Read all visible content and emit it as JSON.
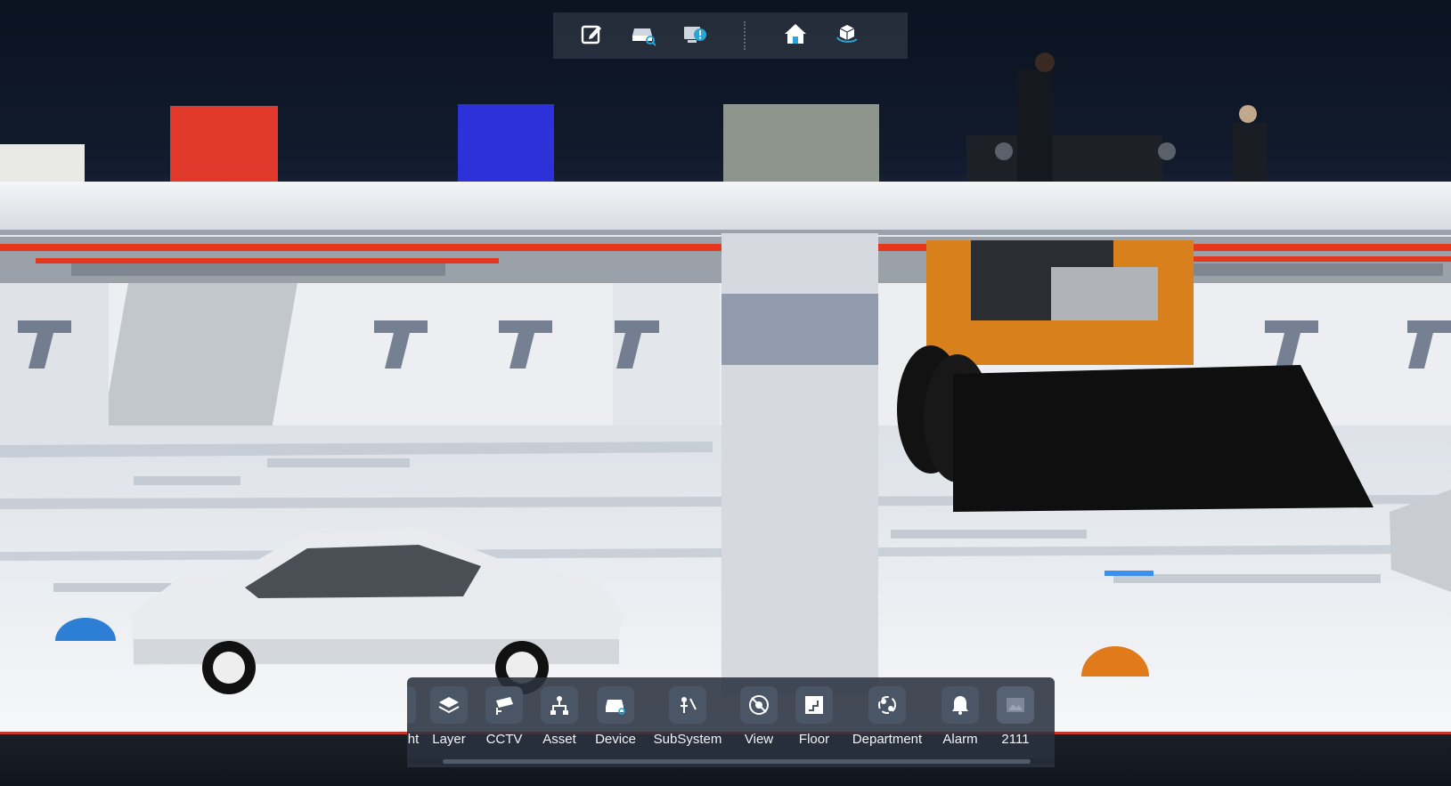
{
  "toolbar": {
    "buttons": [
      {
        "icon": "edit-icon"
      },
      {
        "icon": "device-search-icon"
      },
      {
        "icon": "device-alert-icon"
      },
      {
        "icon": "home-icon"
      },
      {
        "icon": "cube-rotate-icon"
      }
    ]
  },
  "bottom_menu": {
    "items": [
      {
        "label": "ht",
        "icon": "light-icon"
      },
      {
        "label": "Layer",
        "icon": "layer-icon"
      },
      {
        "label": "CCTV",
        "icon": "cctv-icon"
      },
      {
        "label": "Asset",
        "icon": "asset-icon"
      },
      {
        "label": "Device",
        "icon": "device-icon"
      },
      {
        "label": "SubSystem",
        "icon": "subsystem-icon"
      },
      {
        "label": "View",
        "icon": "view-icon"
      },
      {
        "label": "Floor",
        "icon": "floor-icon"
      },
      {
        "label": "Department",
        "icon": "department-icon"
      },
      {
        "label": "Alarm",
        "icon": "alarm-icon"
      },
      {
        "label": "2111",
        "icon": "image-placeholder-icon"
      }
    ]
  },
  "colors": {
    "panel": "#2a3240",
    "icon_tile": "#4a5566",
    "accent_alert": "#2aa7d6",
    "red_box": "#e0392c",
    "blue_box": "#2c32d8",
    "loader_orange": "#d8801c"
  }
}
